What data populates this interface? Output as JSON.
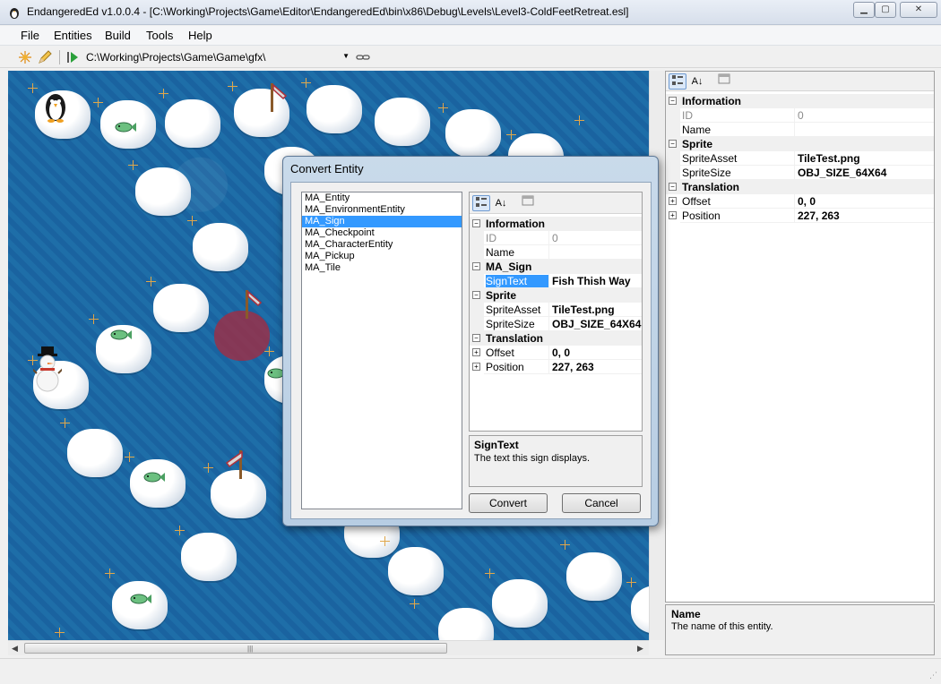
{
  "window": {
    "title": "EndangeredEd v1.0.0.4 - [C:\\Working\\Projects\\Game\\Editor\\EndangeredEd\\bin\\x86\\Debug\\Levels\\Level3-ColdFeetRetreat.esl]",
    "min_glyph": "▁",
    "max_glyph": "▢",
    "close_glyph": "✕"
  },
  "menu": {
    "file": "File",
    "entities": "Entities",
    "build": "Build",
    "tools": "Tools",
    "help": "Help"
  },
  "toolbar": {
    "path": "C:\\Working\\Projects\\Game\\Game\\gfx\\",
    "dropdown_glyph": "▼"
  },
  "propgrid": {
    "sort_alpha_glyph": "A↓",
    "categories": {
      "information": "Information",
      "sprite": "Sprite",
      "translation": "Translation"
    },
    "rows": {
      "id_name": "ID",
      "id_value": "0",
      "name_name": "Name",
      "name_value": "",
      "sprite_asset_name": "SpriteAsset",
      "sprite_asset_value": "TileTest.png",
      "sprite_size_name": "SpriteSize",
      "sprite_size_value": "OBJ_SIZE_64X64",
      "offset_name": "Offset",
      "offset_value": "0, 0",
      "position_name": "Position",
      "position_value": "227, 263"
    },
    "description": {
      "title": "Name",
      "text": "The name of this entity."
    }
  },
  "dialog": {
    "title": "Convert Entity",
    "entity_types": [
      "MA_Entity",
      "MA_EnvironmentEntity",
      "MA_Sign",
      "MA_Checkpoint",
      "MA_CharacterEntity",
      "MA_Pickup",
      "MA_Tile"
    ],
    "selected_index": 2,
    "categories": {
      "information": "Information",
      "sign": "MA_Sign",
      "sprite": "Sprite",
      "translation": "Translation"
    },
    "rows": {
      "id_name": "ID",
      "id_value": "0",
      "name_name": "Name",
      "name_value": "",
      "sign_text_name": "SignText",
      "sign_text_value": "Fish Thish Way",
      "sprite_asset_name": "SpriteAsset",
      "sprite_asset_value": "TileTest.png",
      "sprite_size_name": "SpriteSize",
      "sprite_size_value": "OBJ_SIZE_64X64",
      "offset_name": "Offset",
      "offset_value": "0, 0",
      "position_name": "Position",
      "position_value": "227, 263"
    },
    "description": {
      "title": "SignText",
      "text": "The text this sign displays."
    },
    "convert_label": "Convert",
    "cancel_label": "Cancel"
  },
  "colors": {
    "water": "#1d67a3",
    "selection": "#3399ff",
    "selected_entity": "#aa283c"
  }
}
